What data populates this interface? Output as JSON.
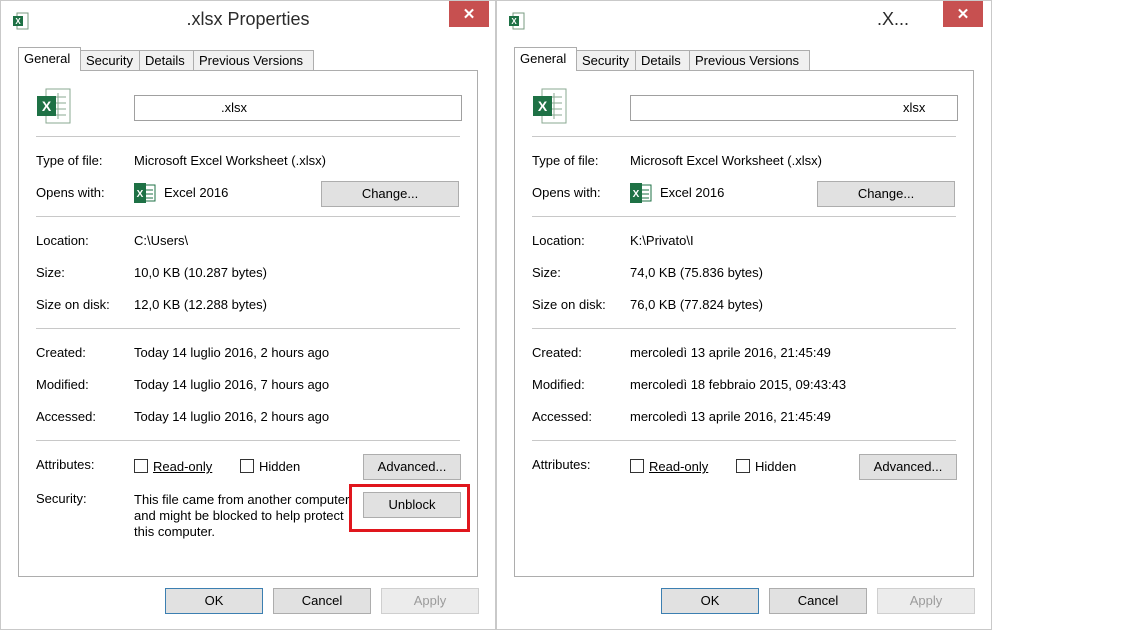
{
  "left": {
    "title": ".xlsx Properties",
    "tabs": [
      "General",
      "Security",
      "Details",
      "Previous Versions"
    ],
    "file_name": ".xlsx",
    "type_of_file_label": "Type of file:",
    "type_of_file": "Microsoft Excel Worksheet (.xlsx)",
    "opens_with_label": "Opens with:",
    "opens_with": "Excel 2016",
    "change_label": "Change...",
    "location_label": "Location:",
    "location": "C:\\Users\\",
    "size_label": "Size:",
    "size": "10,0 KB (10.287 bytes)",
    "size_on_disk_label": "Size on disk:",
    "size_on_disk": "12,0 KB (12.288 bytes)",
    "created_label": "Created:",
    "created": "Today 14 luglio 2016, 2 hours ago",
    "modified_label": "Modified:",
    "modified": "Today 14 luglio 2016, 7 hours ago",
    "accessed_label": "Accessed:",
    "accessed": "Today 14 luglio 2016, 2 hours ago",
    "attributes_label": "Attributes:",
    "readonly_label": "Read-only",
    "hidden_label": "Hidden",
    "advanced_label": "Advanced...",
    "security_label": "Security:",
    "security_text": "This file came from another computer and might be blocked to help protect this computer.",
    "unblock_label": "Unblock",
    "ok_label": "OK",
    "cancel_label": "Cancel",
    "apply_label": "Apply"
  },
  "right": {
    "title": ".X...",
    "tabs": [
      "General",
      "Security",
      "Details",
      "Previous Versions"
    ],
    "file_name": "xlsx",
    "type_of_file_label": "Type of file:",
    "type_of_file": "Microsoft Excel Worksheet (.xlsx)",
    "opens_with_label": "Opens with:",
    "opens_with": "Excel 2016",
    "change_label": "Change...",
    "location_label": "Location:",
    "location": "K:\\Privato\\I",
    "size_label": "Size:",
    "size": "74,0 KB (75.836 bytes)",
    "size_on_disk_label": "Size on disk:",
    "size_on_disk": "76,0 KB (77.824 bytes)",
    "created_label": "Created:",
    "created": "mercoledì 13 aprile 2016, 21:45:49",
    "modified_label": "Modified:",
    "modified": "mercoledì 18 febbraio 2015, 09:43:43",
    "accessed_label": "Accessed:",
    "accessed": "mercoledì 13 aprile 2016, 21:45:49",
    "attributes_label": "Attributes:",
    "readonly_label": "Read-only",
    "hidden_label": "Hidden",
    "advanced_label": "Advanced...",
    "ok_label": "OK",
    "cancel_label": "Cancel",
    "apply_label": "Apply"
  },
  "colors": {
    "close_button": "#c75050",
    "highlight_box": "#e0161d",
    "excel_green": "#1e7145"
  },
  "icons": [
    "excel-file-icon",
    "excel-app-icon",
    "close-icon"
  ]
}
